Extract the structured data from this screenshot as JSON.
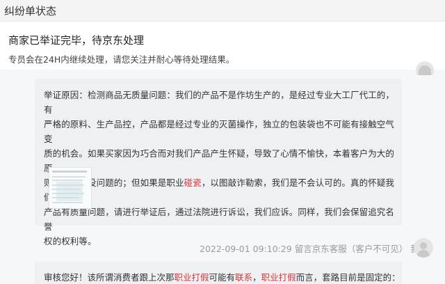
{
  "window": {
    "title": "纠纷单状态"
  },
  "status": {
    "heading": "商家已举证完毕，待京东处理",
    "subtitle": "专员会在24H内继续处理，请您关注并耐心等待处理结果。"
  },
  "message": {
    "line1": "举证原因：检测商品无质量问题：我们的产品不是作坊生产的，是经过专业大工厂代工的，有",
    "line2": "严格的原料、生产品控，产品都是经过专业的灭菌操作，独立的包装袋也不可能有接触空气变",
    "line3": "质的机会。如果买家因为巧合而对我们产品产生怀疑，导致了心情不愉快，本着客户为大的原",
    "line4_before": "则，退款是没问题的；但如果是职业",
    "line4_highlight": "碰瓷",
    "line4_after": "，以图敲诈勒索，我们是不会认可的。真的怀疑我们",
    "line5": "产品有质量问题，请进行举证后，通过法院进行诉讼，我们应诉。同样，我们会保留追究名誉",
    "line6": "权的权利等。",
    "timestamp": "2022-09-01 09:10:29",
    "sender": "留言京东客服（客户不可见）",
    "sender_tail": "我"
  },
  "reply": {
    "part1": "审核您好！该所谓消费者跟上次那",
    "hl1": "职业打假",
    "part2": "可能有",
    "hl2": "联系",
    "part3": "，",
    "hl3": "职业打假",
    "part4": "而言，套路目前是固定的："
  },
  "colors": {
    "highlight": "#d9363e",
    "card_bg": "#eef0f2",
    "meta_text": "#999999"
  }
}
